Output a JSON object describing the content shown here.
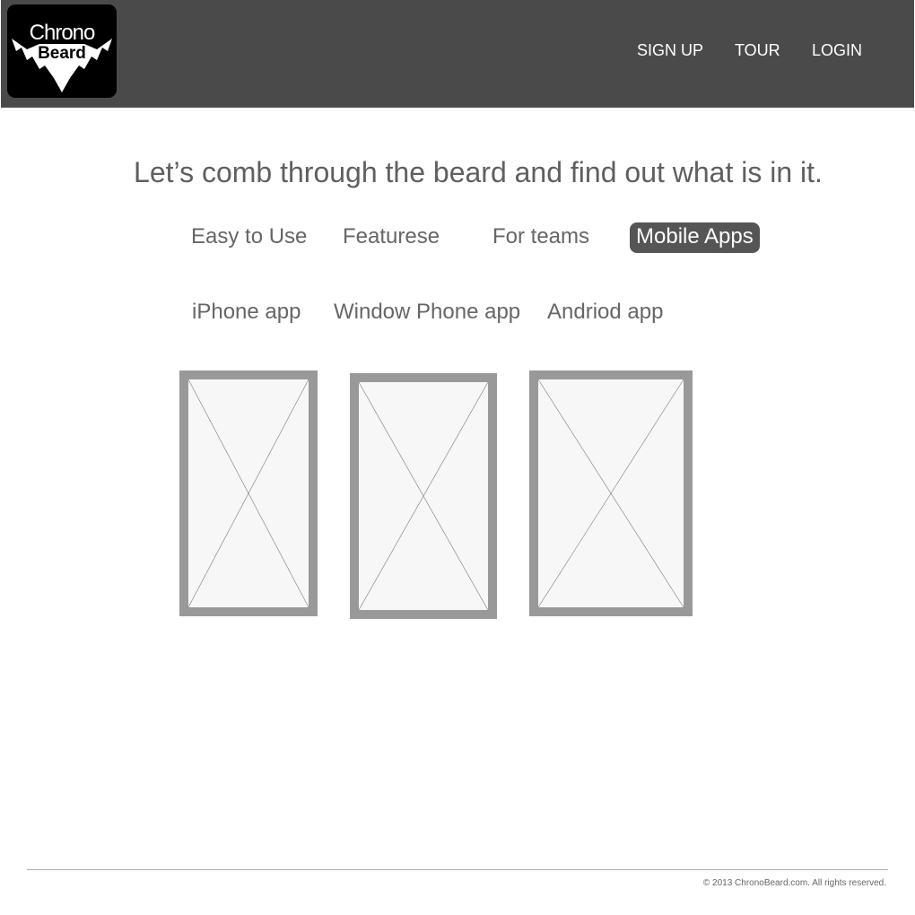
{
  "header": {
    "logo": {
      "line1": "Chrono",
      "line2": "Beard"
    },
    "nav": {
      "signup": "SIGN UP",
      "tour": "TOUR",
      "login": "LOGIN"
    }
  },
  "main": {
    "headline": "Let’s comb through the beard and find out what is in it.",
    "tabs": {
      "easy": "Easy to Use",
      "features": "Featurese",
      "teams": "For teams",
      "mobile": "Mobile Apps"
    },
    "active_tab": "Mobile Apps",
    "subtabs": {
      "iphone": "iPhone app",
      "windows": "Window Phone app",
      "android": "Andriod app"
    },
    "screenshot_placeholders": [
      "image-placeholder",
      "image-placeholder",
      "image-placeholder"
    ]
  },
  "footer": {
    "copyright": "© 2013 ChronoBeard.com. All rights reserved."
  },
  "colors": {
    "header_bg": "#4a4a4a",
    "active_tab_bg": "#555555",
    "text_gray": "#666666",
    "placeholder_border": "#999999"
  }
}
